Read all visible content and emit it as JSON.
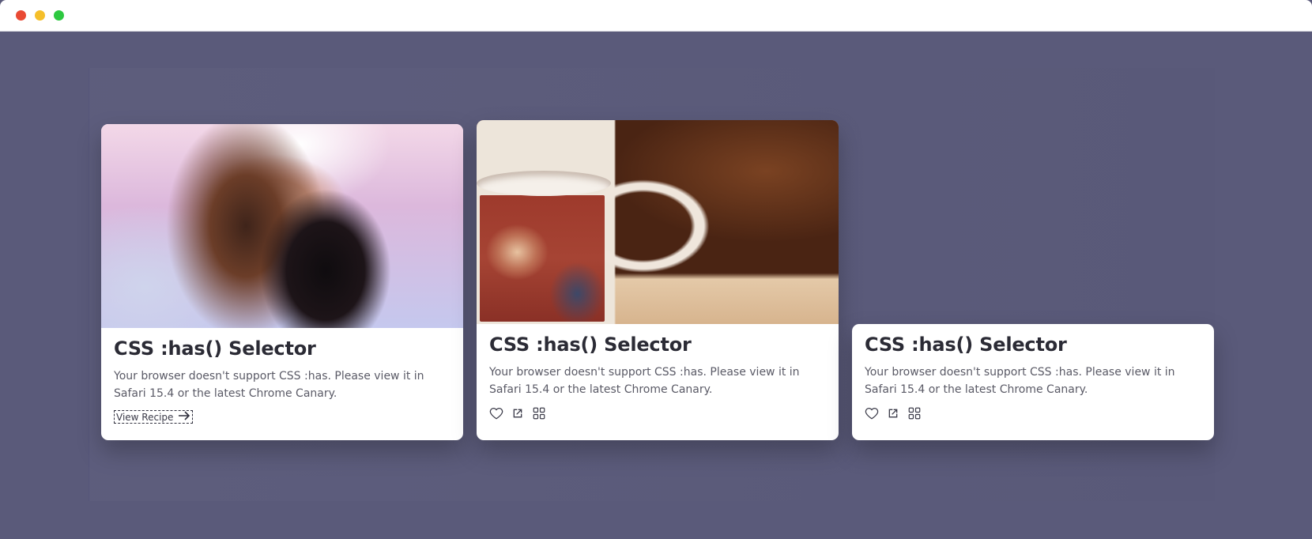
{
  "window": {
    "controls": [
      "close",
      "minimize",
      "zoom"
    ]
  },
  "cards": [
    {
      "title": "CSS :has() Selector",
      "description": "Your browser doesn't support CSS :has. Please view it in Safari 15.4 or the latest Chrome Canary.",
      "link_label": "View Recipe",
      "link_icon": "arrow-right-icon"
    },
    {
      "title": "CSS :has() Selector",
      "description": "Your browser doesn't support CSS :has. Please view it in Safari 15.4 or the latest Chrome Canary.",
      "actions": [
        "heart-icon",
        "share-icon",
        "grid-icon"
      ]
    },
    {
      "title": "CSS :has() Selector",
      "description": "Your browser doesn't support CSS :has. Please view it in Safari 15.4 or the latest Chrome Canary.",
      "actions": [
        "heart-icon",
        "share-icon",
        "grid-icon"
      ]
    }
  ],
  "colors": {
    "background": "#5a5a7a",
    "card": "#ffffff",
    "title": "#2b2b35",
    "text": "#5a5a66"
  }
}
